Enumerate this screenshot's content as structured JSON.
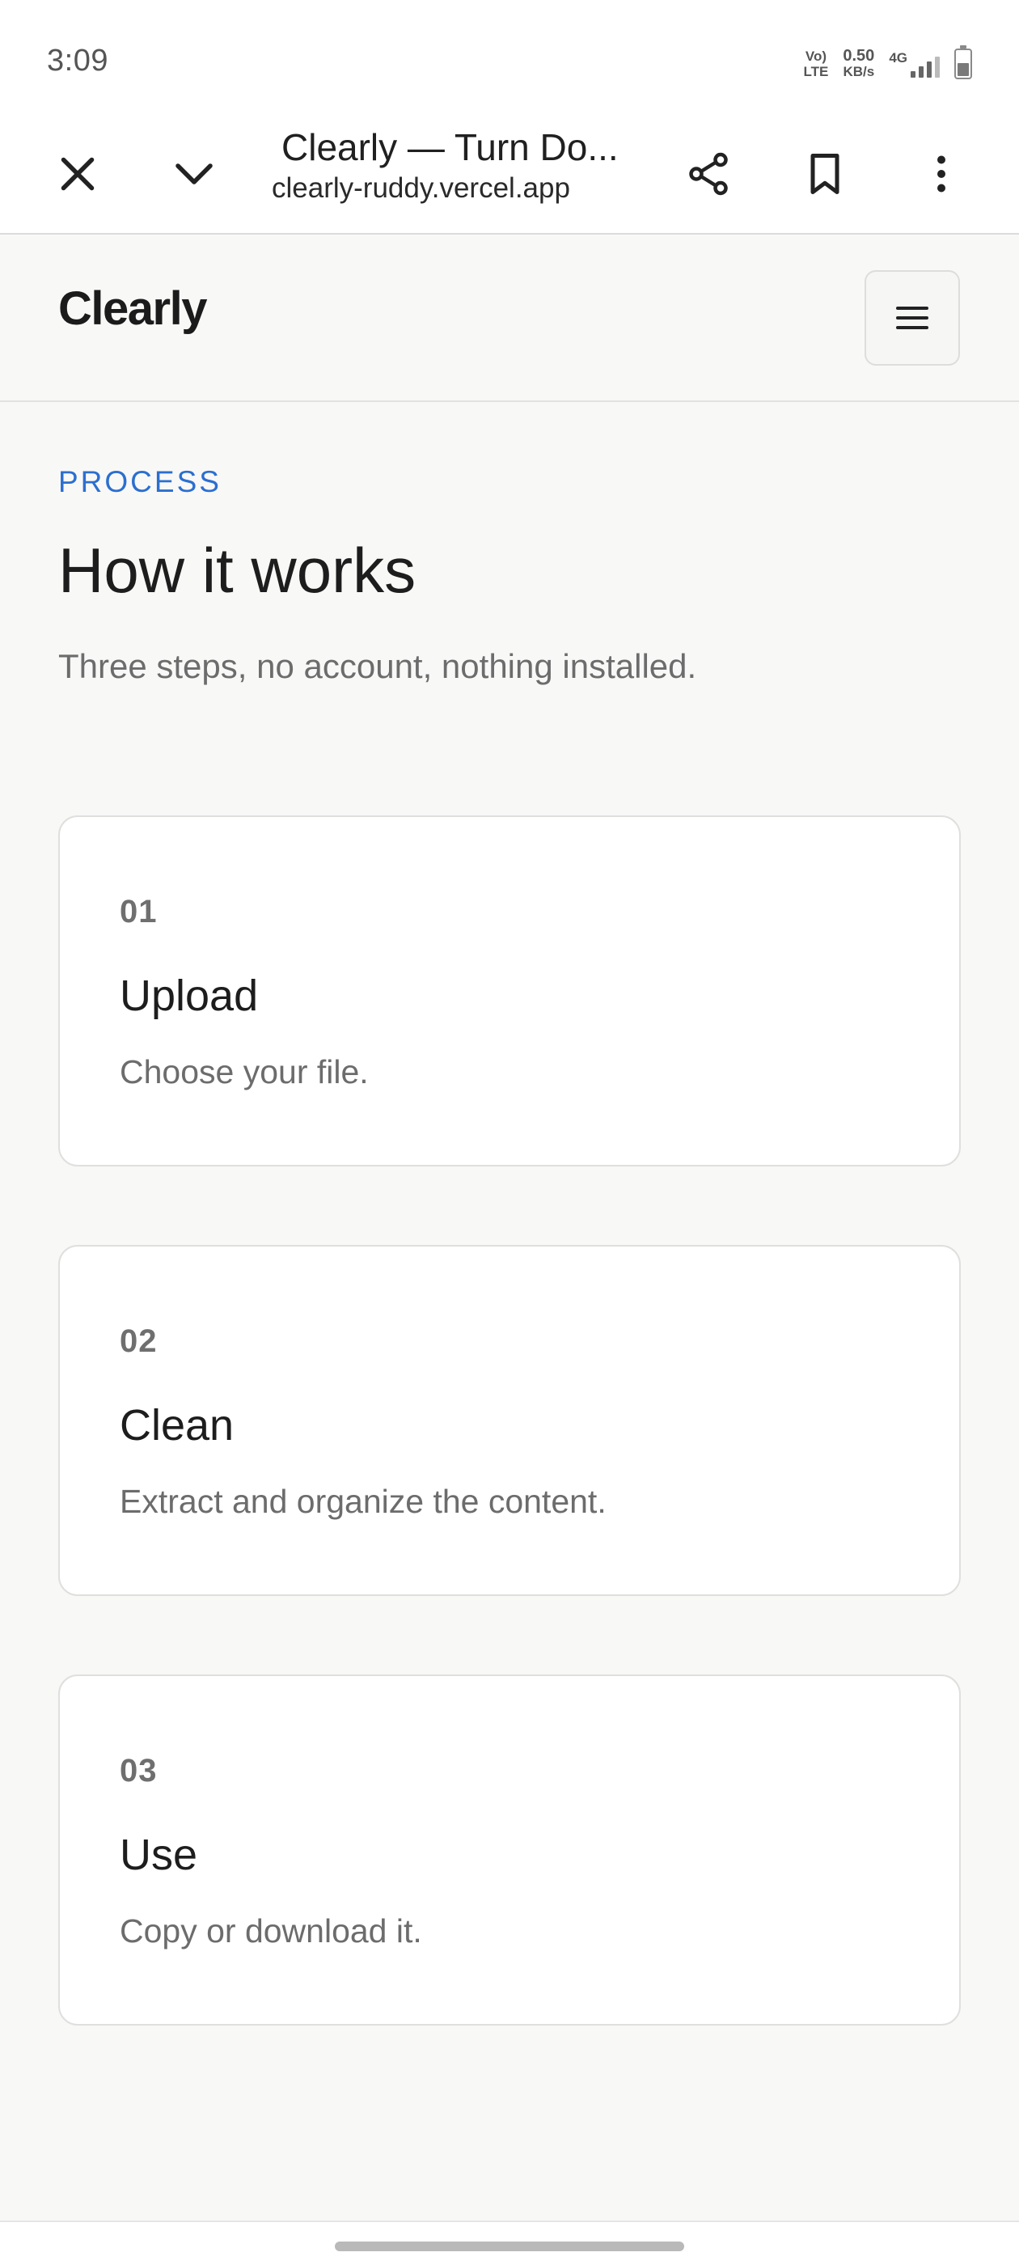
{
  "status_bar": {
    "time": "3:09",
    "volte_top": "Vo)",
    "volte_bottom": "LTE",
    "speed_value": "0.50",
    "speed_unit": "KB/s",
    "network": "4G",
    "battery_level": 0.6
  },
  "browser": {
    "tab_title": "Clearly — Turn Do...",
    "url": "clearly-ruddy.vercel.app",
    "icons": {
      "close": "close-icon",
      "minimize": "chevron-down-icon",
      "share": "share-icon",
      "bookmark": "bookmark-icon",
      "more": "more-vert-icon"
    }
  },
  "header": {
    "brand": "Clearly",
    "menu_icon": "menu-icon"
  },
  "main": {
    "eyebrow": "PROCESS",
    "title": "How it works",
    "subtitle": "Three steps, no account, nothing installed.",
    "steps": [
      {
        "number": "01",
        "title": "Upload",
        "description": "Choose your file."
      },
      {
        "number": "02",
        "title": "Clean",
        "description": "Extract and organize the content."
      },
      {
        "number": "03",
        "title": "Use",
        "description": "Copy or download it."
      }
    ]
  },
  "colors": {
    "accent": "#2b6fcf",
    "page_bg": "#f8f8f7",
    "card_bg": "#ffffff",
    "text_primary": "#1d1d1d",
    "text_muted": "#6c6c6c"
  }
}
